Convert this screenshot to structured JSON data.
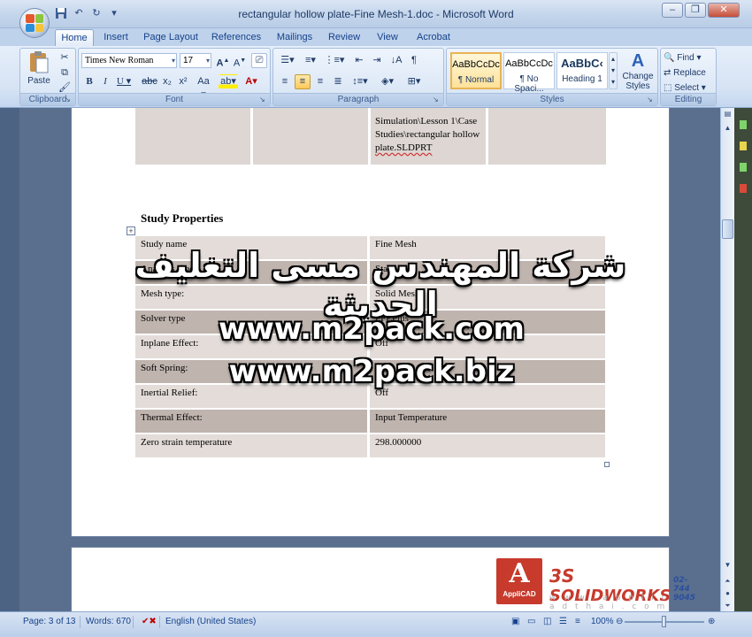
{
  "window": {
    "title": "rectangular hollow plate-Fine Mesh-1.doc - Microsoft Word",
    "minimize": "–",
    "restore": "❐",
    "close": "✕"
  },
  "qat": {
    "save_icon": "save-icon",
    "undo_icon": "undo-icon",
    "redo_icon": "redo-icon"
  },
  "tabs": [
    "Home",
    "Insert",
    "Page Layout",
    "References",
    "Mailings",
    "Review",
    "View",
    "Acrobat"
  ],
  "ribbon": {
    "clipboard": {
      "label": "Clipboard",
      "paste": "Paste"
    },
    "font": {
      "label": "Font",
      "font_name": "Times New Roman",
      "font_size": "17"
    },
    "paragraph": {
      "label": "Paragraph"
    },
    "styles": {
      "label": "Styles",
      "items": [
        {
          "sample": "AaBbCcDc",
          "name": "¶ Normal"
        },
        {
          "sample": "AaBbCcDc",
          "name": "¶ No Spaci..."
        },
        {
          "sample": "AaBbC‹",
          "name": "Heading 1"
        }
      ],
      "change_styles": "Change Styles"
    },
    "editing": {
      "label": "Editing",
      "find": "Find",
      "replace": "Replace",
      "select": "Select"
    }
  },
  "document": {
    "top_cell_lines": [
      "Simulation\\Lesson 1\\Case",
      "Studies\\rectangular hollow",
      "plate.SLDPRT"
    ],
    "heading": "Study Properties",
    "rows": [
      {
        "label": "Study name",
        "value": "Fine Mesh"
      },
      {
        "label": "Analysis type",
        "value": "Static"
      },
      {
        "label": "Mesh type:",
        "value": "Solid Mesh"
      },
      {
        "label": "Solver type",
        "value": "FFEPlus"
      },
      {
        "label": "Inplane Effect:",
        "value": "Off"
      },
      {
        "label": "Soft Spring:",
        "value": "Off"
      },
      {
        "label": "Inertial Relief:",
        "value": "Off"
      },
      {
        "label": "Thermal Effect:",
        "value": "Input Temperature"
      },
      {
        "label": "Zero strain temperature",
        "value": "298.000000"
      }
    ]
  },
  "watermark": {
    "arabic": "شركة المهندس مسى التغليف الحديثة",
    "url1": "www.m2pack.com",
    "url2": "www.m2pack.biz"
  },
  "logos": {
    "applicad_letter": "A",
    "applicad_name": "AppliCAD",
    "solidworks": "SOLIDWORKS",
    "ds": "3S",
    "website": "w w w . a p p l i c a d t h a i . c o m",
    "phone": "02-744 9045"
  },
  "status": {
    "page": "Page: 3 of 13",
    "words": "Words: 670",
    "language": "English (United States)",
    "zoom": "100%"
  },
  "colors": {
    "accent": "#15428b",
    "table_dark": "#bfb4ae",
    "table_light": "#e3dcd8"
  }
}
